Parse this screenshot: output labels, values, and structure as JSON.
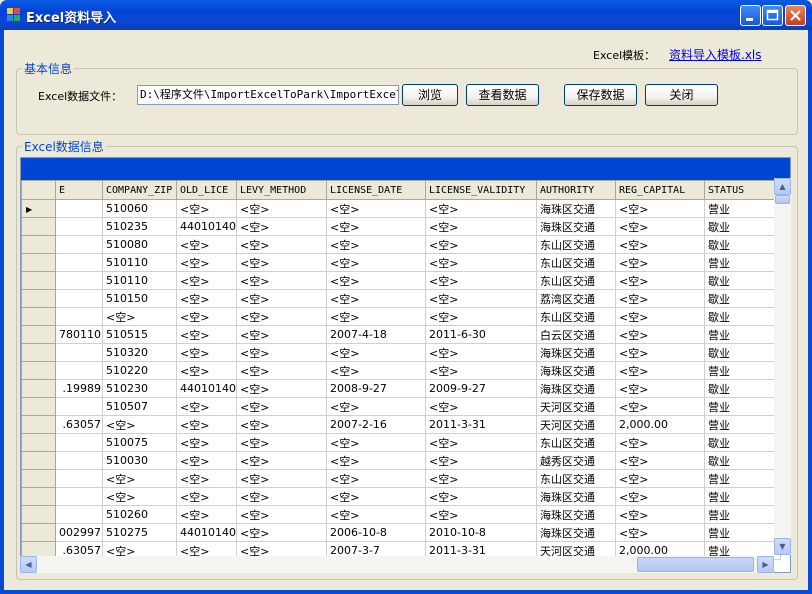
{
  "window": {
    "title": "Excel资料导入"
  },
  "template": {
    "label": "Excel模板：",
    "link": "资料导入模板.xls"
  },
  "basic_group": {
    "title": "基本信息"
  },
  "file": {
    "label": "Excel数据文件：",
    "path": "D:\\程序文件\\ImportExcelToPark\\ImportExcelTo"
  },
  "buttons": {
    "browse": "浏览",
    "view": "查看数据",
    "save": "保存数据",
    "close": "关闭"
  },
  "data_group": {
    "title": "Excel数据信息"
  },
  "grid": {
    "columns": [
      "E",
      "COMPANY_ZIP",
      "OLD_LICE",
      "LEVY_METHOD",
      "LICENSE_DATE",
      "LICENSE_VALIDITY",
      "AUTHORITY",
      "REG_CAPITAL",
      "STATUS"
    ],
    "current_row_marker": "▶",
    "rows": [
      [
        "",
        "510060",
        "<空>",
        "<空>",
        "<空>",
        "<空>",
        "海珠区交通",
        "<空>",
        "营业"
      ],
      [
        "",
        "510235",
        "44010140",
        "<空>",
        "<空>",
        "<空>",
        "海珠区交通",
        "<空>",
        "歇业"
      ],
      [
        "",
        "510080",
        "<空>",
        "<空>",
        "<空>",
        "<空>",
        "东山区交通",
        "<空>",
        "歇业"
      ],
      [
        "",
        "510110",
        "<空>",
        "<空>",
        "<空>",
        "<空>",
        "东山区交通",
        "<空>",
        "营业"
      ],
      [
        "",
        "510110",
        "<空>",
        "<空>",
        "<空>",
        "<空>",
        "东山区交通",
        "<空>",
        "歇业"
      ],
      [
        "",
        "510150",
        "<空>",
        "<空>",
        "<空>",
        "<空>",
        "荔湾区交通",
        "<空>",
        "歇业"
      ],
      [
        "",
        "<空>",
        "<空>",
        "<空>",
        "<空>",
        "<空>",
        "东山区交通",
        "<空>",
        "歇业"
      ],
      [
        "780110",
        "510515",
        "<空>",
        "<空>",
        "2007-4-18",
        "2011-6-30",
        "白云区交通",
        "<空>",
        "营业"
      ],
      [
        "",
        "510320",
        "<空>",
        "<空>",
        "<空>",
        "<空>",
        "海珠区交通",
        "<空>",
        "歇业"
      ],
      [
        "",
        "510220",
        "<空>",
        "<空>",
        "<空>",
        "<空>",
        "海珠区交通",
        "<空>",
        "营业"
      ],
      [
        ".19989",
        "510230",
        "44010140",
        "<空>",
        "2008-9-27",
        "2009-9-27",
        "海珠区交通",
        "<空>",
        "歇业"
      ],
      [
        "",
        "510507",
        "<空>",
        "<空>",
        "<空>",
        "<空>",
        "天河区交通",
        "<空>",
        "营业"
      ],
      [
        ".63057",
        "<空>",
        "<空>",
        "<空>",
        "2007-2-16",
        "2011-3-31",
        "天河区交通",
        "2,000.00",
        "营业"
      ],
      [
        "",
        "510075",
        "<空>",
        "<空>",
        "<空>",
        "<空>",
        "东山区交通",
        "<空>",
        "歇业"
      ],
      [
        "",
        "510030",
        "<空>",
        "<空>",
        "<空>",
        "<空>",
        "越秀区交通",
        "<空>",
        "歇业"
      ],
      [
        "",
        "<空>",
        "<空>",
        "<空>",
        "<空>",
        "<空>",
        "东山区交通",
        "<空>",
        "营业"
      ],
      [
        "",
        "<空>",
        "<空>",
        "<空>",
        "<空>",
        "<空>",
        "海珠区交通",
        "<空>",
        "营业"
      ],
      [
        "",
        "510260",
        "<空>",
        "<空>",
        "<空>",
        "<空>",
        "海珠区交通",
        "<空>",
        "营业"
      ],
      [
        "002997",
        "510275",
        "44010140",
        "<空>",
        "2006-10-8",
        "2010-10-8",
        "海珠区交通",
        "<空>",
        "营业"
      ],
      [
        ".63057",
        "<空>",
        "<空>",
        "<空>",
        "2007-3-7",
        "2011-3-31",
        "天河区交通",
        "2,000.00",
        "营业"
      ]
    ]
  }
}
